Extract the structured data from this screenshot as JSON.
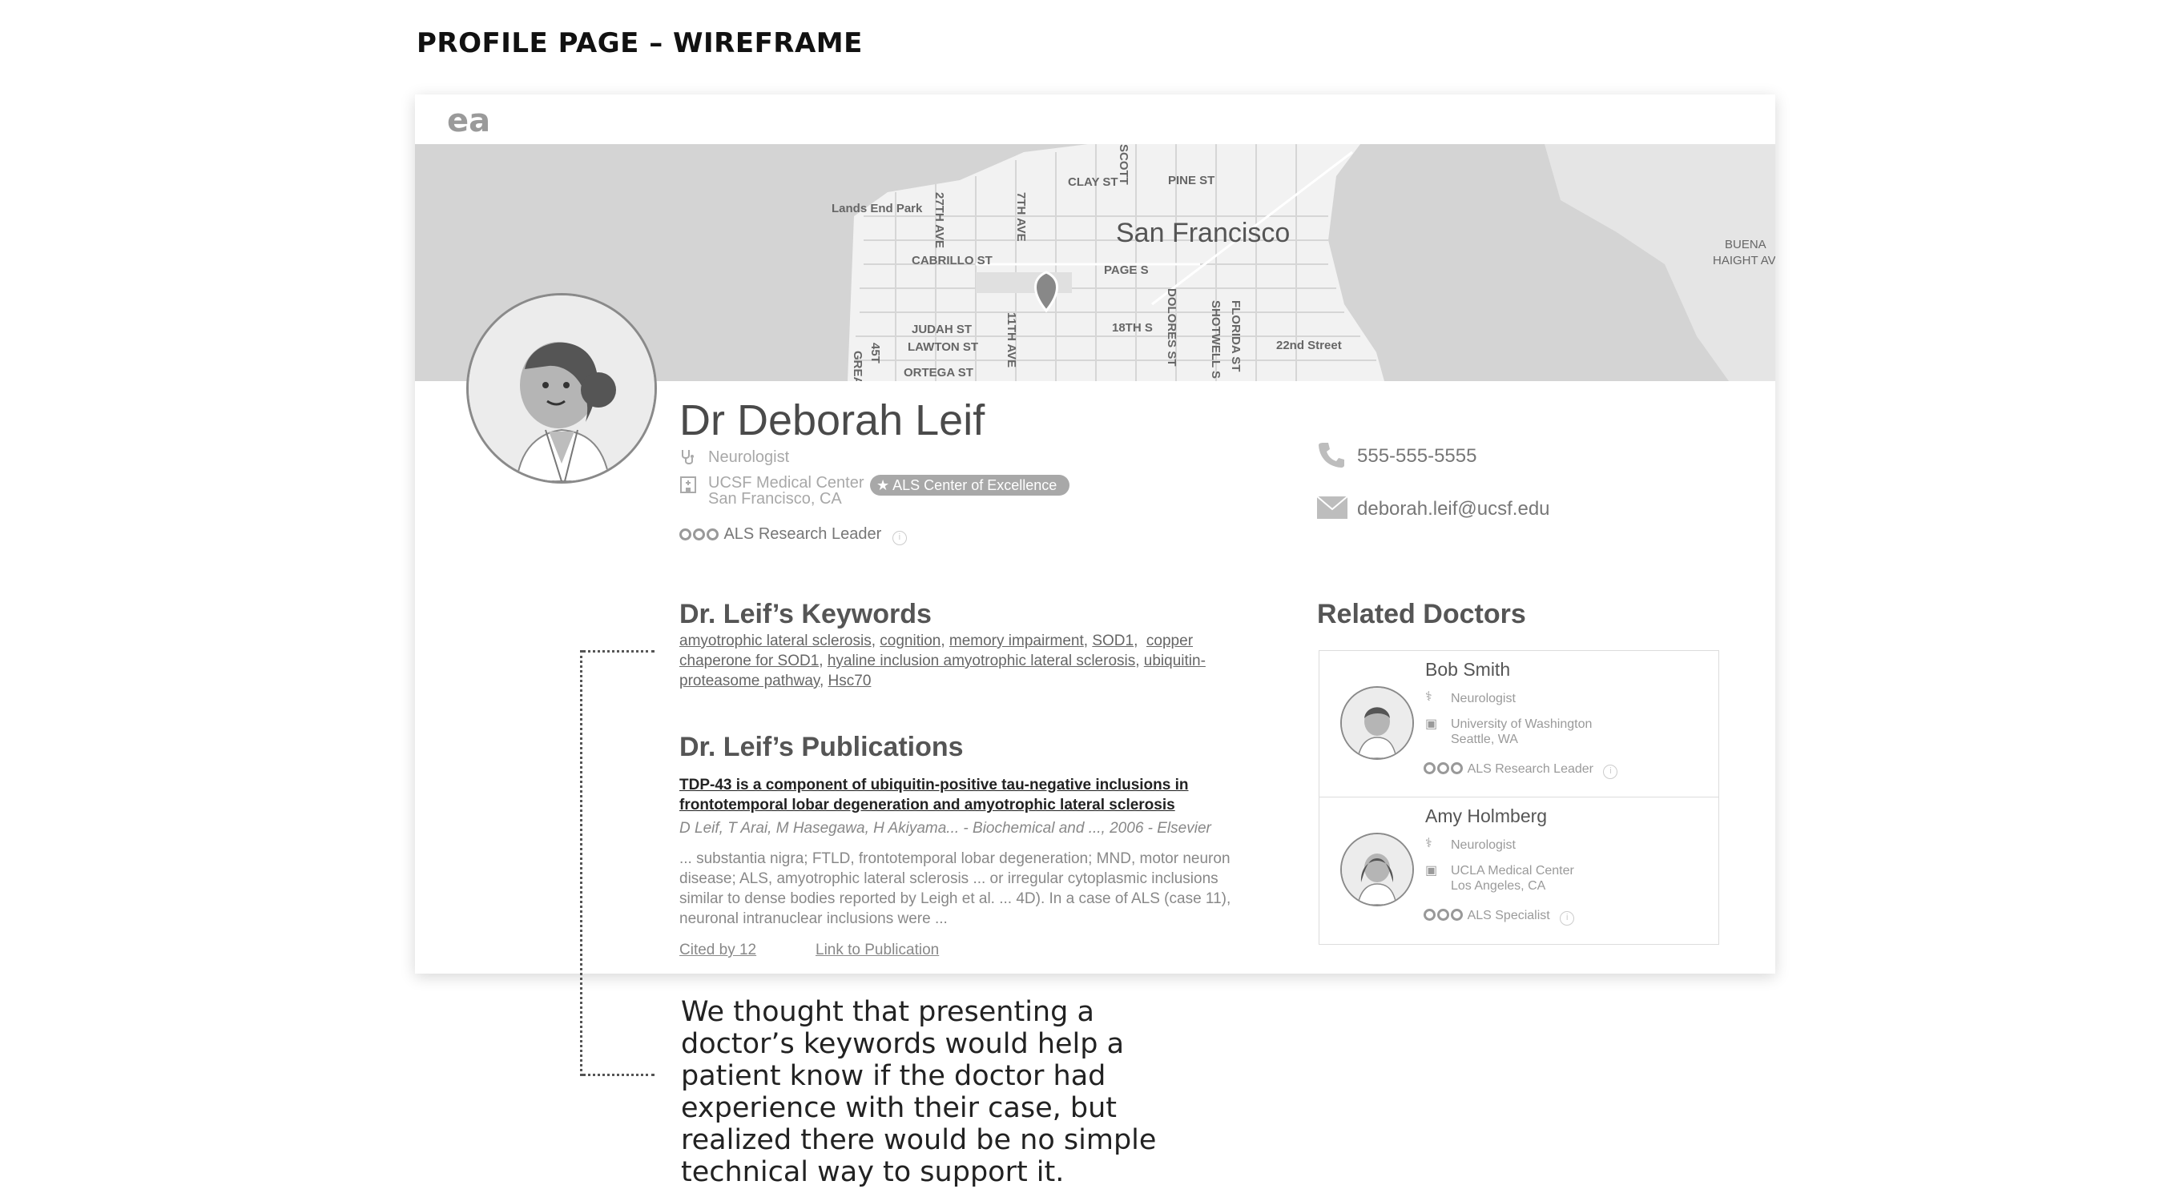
{
  "page_title": "PROFILE PAGE – WIREFRAME",
  "logo_text": "ea",
  "map": {
    "labels": [
      "Lands End Park",
      "CLAY ST",
      "PINE ST",
      "San Francisco",
      "CABRILLO ST",
      "PAGE S",
      "27TH AVE",
      "7TH AVE",
      "JUDAH ST",
      "LAWTON ST",
      "11TH AVE",
      "18TH S",
      "DOLORES ST",
      "SHOTWELL S",
      "FLORIDA ST",
      "22nd Street",
      "ORTEGA ST",
      "BUENA",
      "HAIGHT AV",
      "45T",
      "GREA",
      "SCOTT"
    ]
  },
  "doctor": {
    "name": "Dr Deborah Leif",
    "specialty": "Neurologist",
    "institution": "UCSF Medical Center",
    "location": "San Francisco, CA",
    "badge": "ALS Center of Excellence",
    "leader": "ALS Research Leader",
    "phone": "555-555-5555",
    "email": "deborah.leif@ucsf.edu"
  },
  "keywords": {
    "heading": "Dr. Leif’s Keywords",
    "items": [
      "amyotrophic lateral sclerosis",
      "cognition",
      "memory impairment",
      "SOD1",
      "copper chaperone for SOD1",
      "hyaline inclusion amyotrophic lateral sclerosis",
      "ubiquitin-proteasome pathway",
      "Hsc70"
    ]
  },
  "publications": {
    "heading": "Dr. Leif’s Publications",
    "title": "TDP-43 is a component of ubiquitin-positive tau-negative inclusions in frontotemporal lobar degeneration and amyotrophic lateral sclerosis",
    "authors": "D Leif, T Arai, M Hasegawa, H Akiyama... - Biochemical and ..., 2006 - Elsevier",
    "snippet": "... substantia nigra; FTLD, frontotemporal lobar degeneration; MND, motor neuron disease; ALS, amyotrophic lateral sclerosis ... or irregular cytoplasmic inclusions similar to dense bodies reported by Leigh et al. ... 4D). In a case of ALS (case 11), neuronal intranuclear inclusions were ...",
    "cited": "Cited by 12",
    "link": "Link to Publication"
  },
  "related": {
    "heading": "Related Doctors",
    "doctors": [
      {
        "name": "Bob Smith",
        "specialty": "Neurologist",
        "institution": "University of Washington",
        "location": "Seattle, WA",
        "rank": "ALS Research Leader"
      },
      {
        "name": "Amy Holmberg",
        "specialty": "Neurologist",
        "institution": "UCLA Medical Center",
        "location": "Los Angeles, CA",
        "rank": "ALS Specialist"
      }
    ]
  },
  "note": "We thought that presenting a doctor’s keywords would help a patient know if the doctor had experience with their case, but realized there would be no simple technical way to support it.",
  "icons": [
    "stethoscope-icon",
    "hospital-icon",
    "star-icon",
    "rank-dots-icon",
    "info-icon",
    "phone-icon",
    "mail-icon",
    "map-pin-icon"
  ],
  "colors": {
    "map_land": "#d4d4d4",
    "map_city": "#f2f2f2",
    "badge": "#a8a8a8",
    "text_dark": "#4a4a4a"
  }
}
